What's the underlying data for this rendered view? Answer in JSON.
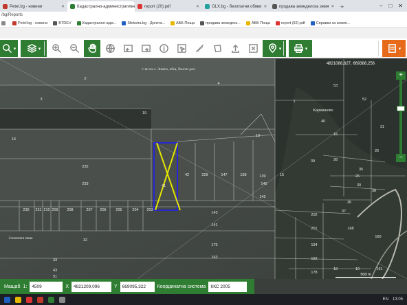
{
  "browser": {
    "tabs": [
      {
        "title": "Petel.bg - новини",
        "color": "#c0392b",
        "active": false
      },
      {
        "title": "Кадастрално-административна",
        "color": "#2e7d32",
        "active": true
      },
      {
        "title": "report (20).pdf",
        "color": "#d33",
        "active": false
      },
      {
        "title": "OLX.bg - безплатни обяви",
        "color": "#23a0a0",
        "active": false
      },
      {
        "title": "продава земеделска земя",
        "color": "#555",
        "active": false
      }
    ],
    "new_tab": "+",
    "window_buttons": [
      "–",
      "□",
      "✕"
    ],
    "url": "/bg/Reports",
    "bookmarks": [
      {
        "label": "",
        "color": "#888"
      },
      {
        "label": "Petel.bg - новини",
        "color": "#c0392b"
      },
      {
        "label": "BTDEV",
        "color": "#555"
      },
      {
        "label": "Кадастрално-адм...",
        "color": "#2e7d32"
      },
      {
        "label": "Sfekstra.bg - Дигита...",
        "color": "#1f5fbf"
      },
      {
        "label": "АББ Поща",
        "color": "#e6b800"
      },
      {
        "label": "продава земедекз...",
        "color": "#555"
      },
      {
        "label": "АББ Поща",
        "color": "#e6b800"
      },
      {
        "label": "report (92).pdf",
        "color": "#d33"
      },
      {
        "label": "Справки за земеп...",
        "color": "#1f5fbf"
      }
    ]
  },
  "toolbar": {
    "items": [
      {
        "name": "search-tool-button",
        "icon": "search-icon",
        "style": "green",
        "caret": true
      },
      {
        "name": "layers-button",
        "icon": "layers-icon",
        "style": "green",
        "caret": true
      },
      {
        "name": "zoom-in-button",
        "icon": "zoom-in-icon",
        "style": "grey"
      },
      {
        "name": "zoom-out-button",
        "icon": "zoom-out-icon",
        "style": "grey"
      },
      {
        "name": "pan-button",
        "icon": "hand-icon",
        "style": "green"
      },
      {
        "name": "globe-button",
        "icon": "globe-icon",
        "style": "grey"
      },
      {
        "name": "back-extent-button",
        "icon": "back-icon",
        "style": "grey"
      },
      {
        "name": "forward-extent-button",
        "icon": "forward-icon",
        "style": "grey"
      },
      {
        "name": "info-button",
        "icon": "info-icon",
        "style": "grey"
      },
      {
        "name": "select-parcel-button",
        "icon": "select-icon",
        "style": "grey"
      },
      {
        "name": "measure-distance-button",
        "icon": "ruler-icon",
        "style": "grey"
      },
      {
        "name": "measure-area-button",
        "icon": "area-icon",
        "style": "grey"
      },
      {
        "name": "upload-button",
        "icon": "upload-icon",
        "style": "grey"
      },
      {
        "name": "clear-selection-button",
        "icon": "clear-icon",
        "style": "grey"
      },
      {
        "name": "location-button",
        "icon": "marker-icon",
        "style": "green",
        "caret": true
      },
      {
        "name": "print-button",
        "icon": "print-icon",
        "style": "green",
        "caret": true
      },
      {
        "name": "menu-button",
        "icon": "menu-icon",
        "style": "orange",
        "caret": true
      }
    ]
  },
  "map": {
    "header_coords": "4821088,627, 669388,256",
    "road_label": "с-во на с. Зимен, общ. Вълчи дол",
    "locality_label": "Кармашево",
    "field_label": "Злохатата нива",
    "scale_label": "500 m",
    "parcels": [
      "2",
      "3",
      "4",
      "1",
      "13",
      "15",
      "16",
      "19",
      "232",
      "233",
      "28",
      "15",
      "31",
      "26",
      "30",
      "26",
      "35",
      "36",
      "37",
      "38",
      "39",
      "40",
      "41",
      "42",
      "229",
      "147",
      "158",
      "139",
      "140",
      "142",
      "143",
      "141",
      "230",
      "231",
      "210",
      "209",
      "208",
      "207",
      "206",
      "205",
      "204",
      "203",
      "202",
      "201",
      "194",
      "192",
      "178",
      "175",
      "163",
      "32",
      "33",
      "43",
      "51",
      "52",
      "53",
      "18",
      "10",
      "161",
      "168",
      "160",
      "29",
      "25"
    ],
    "accent_boundary": "#1a1aff",
    "cross_color": "#e6e600"
  },
  "coords_bar": {
    "scale_label": "Мащаб",
    "scale_prefix": "1:",
    "scale_value": "4509",
    "x_label": "X",
    "x_value": "4821209,096",
    "y_label": "Y",
    "y_value": "669095,322",
    "system_label": "Координатна система",
    "system_value": "ККС 2005"
  },
  "zoom_control": {
    "plus": "+",
    "minus": "−"
  },
  "taskbar": {
    "apps": [
      "#1f5fbf",
      "#e6b800",
      "#d33",
      "#c0392b",
      "#2e7d32",
      "#888"
    ],
    "lang": "EN",
    "time": "13:05"
  }
}
